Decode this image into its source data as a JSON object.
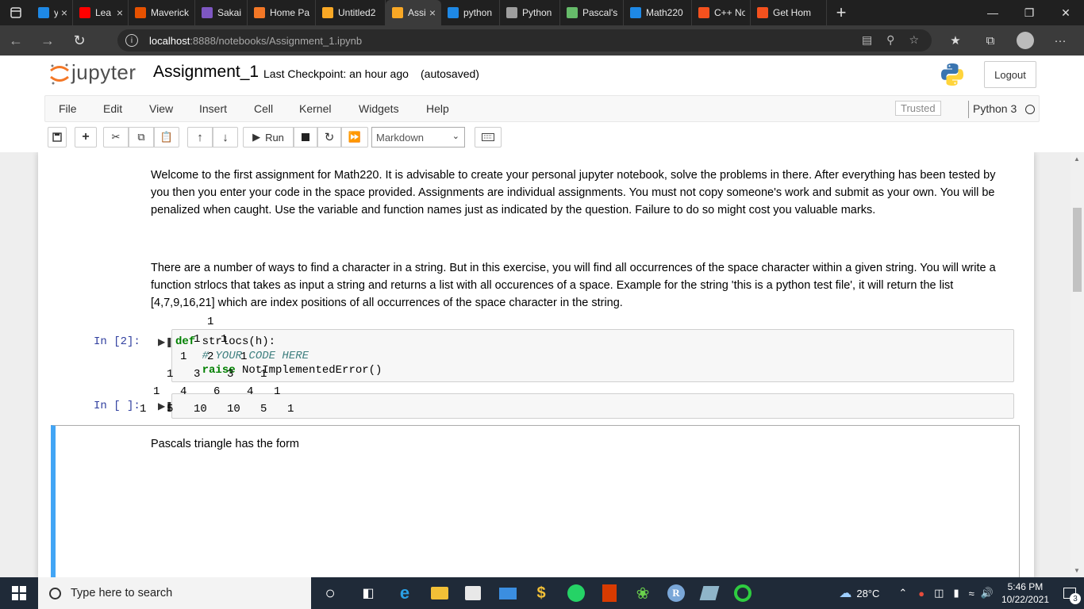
{
  "browser": {
    "tabs": [
      {
        "title": "you",
        "icon": "bing-icon",
        "color": "#1e88e5"
      },
      {
        "title": "Lea",
        "icon": "youtube-icon",
        "color": "#ff0000"
      },
      {
        "title": "Maverick",
        "icon": "maverick-icon",
        "color": "#e65100"
      },
      {
        "title": "Sakai : G",
        "icon": "sakai-icon",
        "color": "#7e57c2"
      },
      {
        "title": "Home Pa",
        "icon": "jupyter-icon",
        "color": "#f37726"
      },
      {
        "title": "Untitled2",
        "icon": "hourglass-icon",
        "color": "#f9a825"
      },
      {
        "title": "Assi",
        "icon": "notebook-icon",
        "color": "#f9a825"
      },
      {
        "title": "python n",
        "icon": "bing-icon",
        "color": "#1e88e5"
      },
      {
        "title": "Python p",
        "icon": "python-site-icon",
        "color": "#9e9e9e"
      },
      {
        "title": "Pascal's",
        "icon": "leaf-icon",
        "color": "#66bb6a"
      },
      {
        "title": "Math220",
        "icon": "edge-icon",
        "color": "#1e88e5"
      },
      {
        "title": "C++ Not",
        "icon": "c-icon",
        "color": "#f4511e"
      },
      {
        "title": "Get Hom",
        "icon": "c-icon",
        "color": "#f4511e"
      }
    ],
    "url_host": "localhost",
    "url_path": ":8888/notebooks/Assignment_1.ipynb"
  },
  "jupyter": {
    "logo_text": "jupyter",
    "notebook_name": "Assignment_1",
    "checkpoint": "Last Checkpoint: an hour ago",
    "autosave": "(autosaved)",
    "logout": "Logout",
    "menu": [
      "File",
      "Edit",
      "View",
      "Insert",
      "Cell",
      "Kernel",
      "Widgets",
      "Help"
    ],
    "trusted": "Trusted",
    "kernel": "Python 3",
    "toolbar": {
      "run_label": "Run",
      "cell_type": "Markdown"
    }
  },
  "cells": {
    "intro": "Welcome to the first assignment for Math220. It is advisable to create your personal jupyter notebook, solve the problems in there. After everything has been tested by you then you enter your code in the space provided. Assignments are individual assignments. You must not copy someone's work and submit as your own. You will be penalized when caught. Use the variable and function names just as indicated by the question. Failure to do so might cost you valuable marks.",
    "task": "There are a number of ways to find a character in a string. But in this exercise, you will find all occurrences of the space character within a given string. You will write a function strlocs that takes as input a string and returns a list with all occurences of a space. Example for the string 'this is a python test file', it will return the list [4,7,9,16,21] which are index positions of all occurrences of the space character in the string.",
    "prompt1": "In [2]:",
    "code": {
      "line1_kw": "def",
      "line1_rest": " strlocs(h):",
      "line2": "    # YOUR CODE HERE",
      "line3_kw": "raise",
      "line3_rest": " NotImplementedError()"
    },
    "prompt2": "In [ ]:",
    "pascal_title": "Pascals triangle has the form",
    "pascal_rows": [
      [
        "1"
      ],
      [
        "1",
        "1"
      ],
      [
        "1",
        "2",
        "1"
      ],
      [
        "1",
        "3",
        "3",
        "1"
      ],
      [
        "1",
        "4",
        "6",
        "4",
        "1"
      ],
      [
        "1",
        "5",
        "10",
        "10",
        "5",
        "1"
      ]
    ]
  },
  "taskbar": {
    "search_placeholder": "Type here to search",
    "weather": "28°C",
    "time": "5:46 PM",
    "date": "10/22/2021",
    "notification_count": "3"
  },
  "colors": {
    "accent": "#42a5f5",
    "prompt": "#303f9f",
    "jupyter_orange": "#f37726"
  }
}
